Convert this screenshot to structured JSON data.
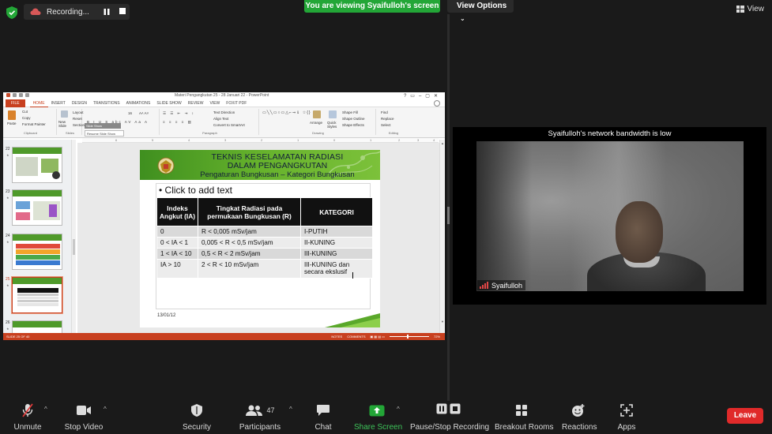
{
  "topbar": {
    "recording_label": "Recording...",
    "viewing_banner": "You are viewing Syaifulloh's screen",
    "view_options_label": "View Options",
    "view_label": "View"
  },
  "ppt": {
    "window_title": "Materi Pengangkutan 25 - 28 Januari 22 - PowerPoint",
    "tabs": [
      "FILE",
      "HOME",
      "INSERT",
      "DESIGN",
      "TRANSITIONS",
      "ANIMATIONS",
      "SLIDE SHOW",
      "REVIEW",
      "VIEW",
      "FOXIT PDF"
    ],
    "active_tab": "HOME",
    "ribbon": {
      "paste": "Paste",
      "cut": "Cut",
      "copy": "Copy",
      "format_painter": "Format Painter",
      "clipboard": "Clipboard",
      "new_slide": "New Slide",
      "layout": "Layout",
      "reset": "Reset",
      "section": "Section",
      "slides": "Slides",
      "font_size": "16",
      "paragraph": "Paragraph",
      "text_direction": "Text Direction",
      "align_text": "Align Text",
      "convert_smartart": "Convert to SmartArt",
      "drawing": "Drawing",
      "arrange": "Arrange",
      "quick_styles": "Quick Styles",
      "shape_fill": "Shape Fill",
      "shape_outline": "Shape Outline",
      "shape_effects": "Shape Effects",
      "find": "Find",
      "replace": "Replace",
      "select": "Select",
      "editing": "Editing",
      "tooltip_1": "Slide Show",
      "tooltip_2": "Resume Slide Show"
    },
    "ruler_marks": [
      "6",
      "5",
      "4",
      "3",
      "2",
      "1",
      "0",
      "1",
      "2",
      "3",
      "4"
    ],
    "thumbnails": [
      {
        "num": "22"
      },
      {
        "num": "23"
      },
      {
        "num": "24"
      },
      {
        "num": "25"
      },
      {
        "num": "26"
      }
    ],
    "status": {
      "slide_info": "SLIDE 25 OF 40",
      "notes": "NOTES",
      "comments": "COMMENTS",
      "zoom": "72%"
    },
    "slide": {
      "title_1": "TEKNIS KESELAMATAN RADIASI",
      "title_2": "DALAM PENGANGKUTAN",
      "title_3": "Pengaturan Bungkusan – Kategori Bungkusan",
      "bullet": "Click to add text",
      "table_headers": [
        "Indeks Angkut (IA)",
        "Tingkat Radiasi pada permukaan Bungkusan (R)",
        "KATEGORI"
      ],
      "table_rows": [
        [
          "0",
          "R < 0,005 mSv/jam",
          "I-PUTIH"
        ],
        [
          "0 < IA < 1",
          "0,005 < R < 0,5 mSv/jam",
          "II-KUNING"
        ],
        [
          "1 < IA < 10",
          "0,5 < R < 2 mSv/jam",
          "III-KUNING"
        ],
        [
          "IA > 10",
          "2 < R < 10 mSv/jam",
          "III-KUNING dan secara ekslusif"
        ]
      ],
      "date": "13/01/12"
    }
  },
  "video": {
    "bandwidth_note": "Syaifulloh's network bandwidth is low",
    "participant_name": "Syaifulloh"
  },
  "toolbar": {
    "unmute": "Unmute",
    "stop_video": "Stop Video",
    "security": "Security",
    "participants": "Participants",
    "participants_count": "47",
    "chat": "Chat",
    "share_screen": "Share Screen",
    "pause_stop_recording": "Pause/Stop Recording",
    "breakout_rooms": "Breakout Rooms",
    "reactions": "Reactions",
    "apps": "Apps",
    "leave": "Leave"
  }
}
